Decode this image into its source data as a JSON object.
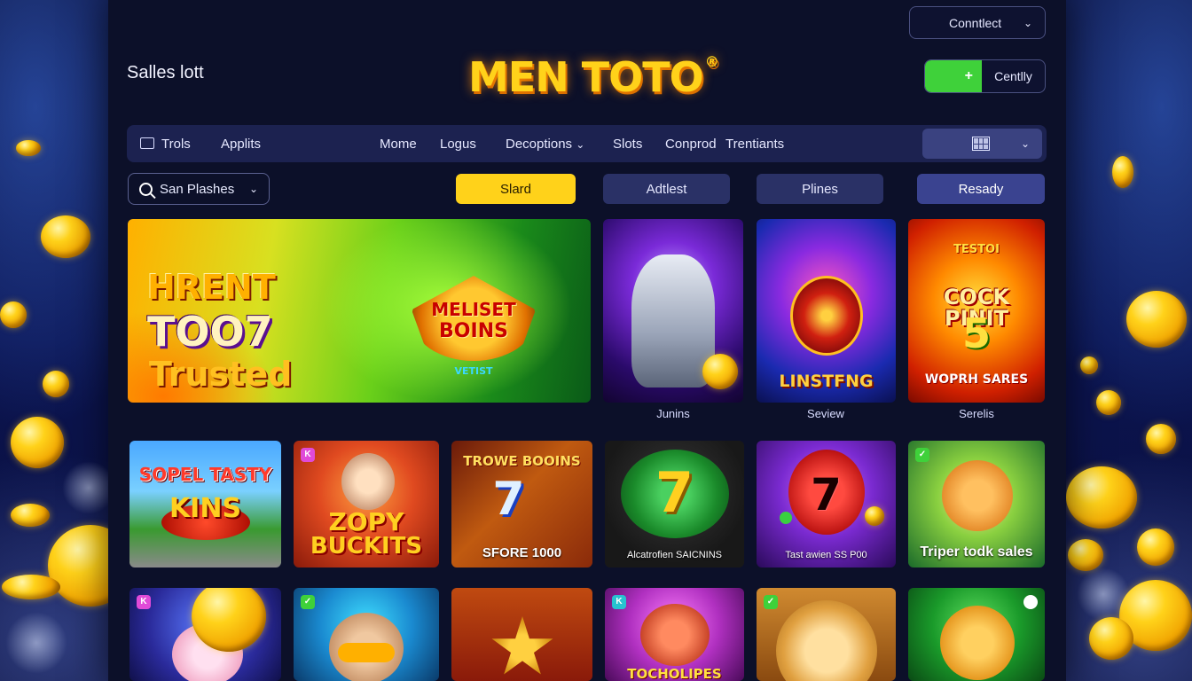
{
  "header": {
    "connect_label": "Conntlect",
    "site_subtitle": "Salles lott",
    "logo": "MEN TOTO",
    "logo_mark": "®",
    "toggle_symbol": "+",
    "toggle_label": "Centlly"
  },
  "nav": {
    "items": [
      {
        "label": "Trols"
      },
      {
        "label": "Applits"
      },
      {
        "label": "Mome"
      },
      {
        "label": "Logus"
      },
      {
        "label": "Decoptions"
      },
      {
        "label": "Slots"
      },
      {
        "label": "Conprod"
      },
      {
        "label": "Trentiants"
      }
    ]
  },
  "filters": {
    "search_label": "San Plashes",
    "pills": [
      {
        "label": "Slard"
      },
      {
        "label": "Adtlest"
      },
      {
        "label": "Plines"
      },
      {
        "label": "Resady"
      }
    ]
  },
  "hero": {
    "left_line1": "HRENT",
    "left_line2": "TOO7",
    "left_line3": "Trusted",
    "right_line1": "MELISET",
    "right_line2": "BOINS",
    "right_line3": "VETIST"
  },
  "featured": [
    {
      "art": "",
      "label": "Junins"
    },
    {
      "art": "LINSTFNG",
      "label": "Seview"
    },
    {
      "art_top": "TESTOI",
      "art": "COCK PINIT",
      "art_num": "5",
      "art_bottom": "WOPRH SARES",
      "label": "Serelis"
    }
  ],
  "games_row1": [
    {
      "art": "SOPEL TASTY",
      "art2": "KINS"
    },
    {
      "art": "ZOPY",
      "art2": "BUCKITS"
    },
    {
      "art": "TROWE BOOINS",
      "art2": "7",
      "caption": "SFORE 1000"
    },
    {
      "art2": "7",
      "caption": "Alcatrofien SAICNINS"
    },
    {
      "art2": "7",
      "caption": "Tast awien SS P00"
    },
    {
      "caption": "Triper todk sales"
    }
  ],
  "games_row2": [
    {
      "art": ""
    },
    {
      "art": ""
    },
    {
      "art": ""
    },
    {
      "art": "TOCHOLIPES"
    },
    {
      "art": ""
    },
    {
      "art": ""
    }
  ]
}
